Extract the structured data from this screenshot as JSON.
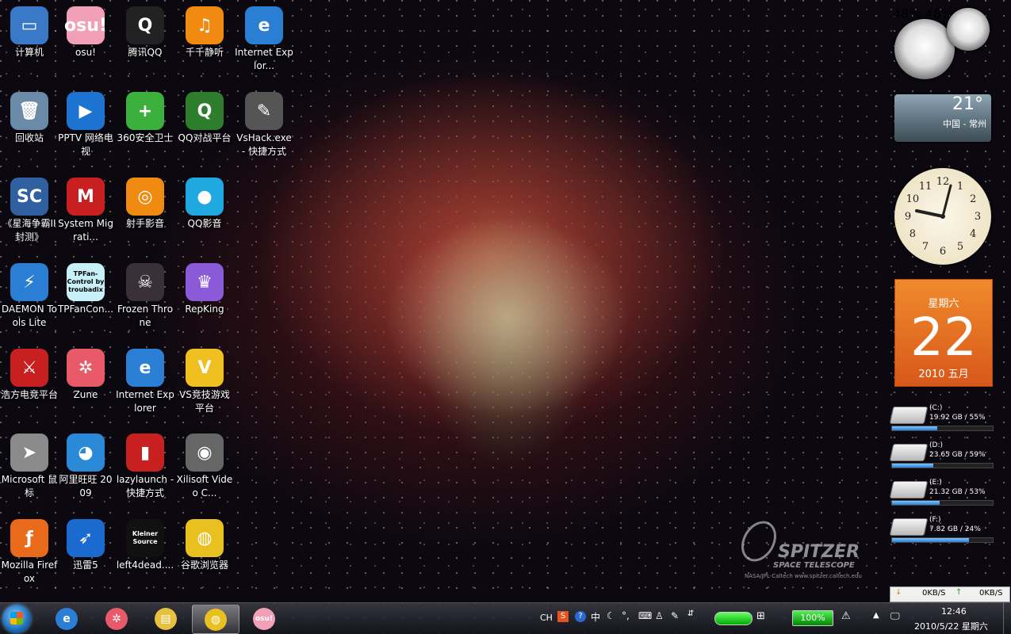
{
  "desktop": {
    "icons": [
      {
        "label": "计算机",
        "glyph": "▭",
        "color": "#3a78c8"
      },
      {
        "label": "osu!",
        "glyph": "osu!",
        "color": "#f2a0b8"
      },
      {
        "label": "腾讯QQ",
        "glyph": "Q",
        "color": "#222"
      },
      {
        "label": "千千静听",
        "glyph": "♫",
        "color": "#f08a10"
      },
      {
        "label": "Internet Explor...",
        "glyph": "e",
        "color": "#2a7fd4"
      },
      {
        "label": "回收站",
        "glyph": "🗑",
        "color": "#6a8aa8"
      },
      {
        "label": "PPTV 网络电视",
        "glyph": "▶",
        "color": "#1c74d0"
      },
      {
        "label": "360安全卫士",
        "glyph": "+",
        "color": "#3cb03c"
      },
      {
        "label": "QQ对战平台",
        "glyph": "Q",
        "color": "#2d7d2d"
      },
      {
        "label": "VsHack.exe - 快捷方式",
        "glyph": "✎",
        "color": "#555"
      },
      {
        "label": "《星海争霸II 封测》",
        "glyph": "SC",
        "color": "#3060a0"
      },
      {
        "label": "System Migrati...",
        "glyph": "M",
        "color": "#c82020"
      },
      {
        "label": "射手影音",
        "glyph": "◎",
        "color": "#f08a10"
      },
      {
        "label": "QQ影音",
        "glyph": "●",
        "color": "#20a8e0"
      },
      {
        "label": "",
        "glyph": "",
        "color": "transparent"
      },
      {
        "label": "DAEMON Tools Lite",
        "glyph": "⚡",
        "color": "#2a7fd4"
      },
      {
        "label": "TPFanCon...",
        "glyph": "TPFan-Control by troubadix",
        "color": "#c8f0f8"
      },
      {
        "label": "Frozen Throne",
        "glyph": "☠",
        "color": "#3a3038"
      },
      {
        "label": "RepKing",
        "glyph": "♛",
        "color": "#8a5ad8"
      },
      {
        "label": "",
        "glyph": "",
        "color": "transparent"
      },
      {
        "label": "浩方电竞平台",
        "glyph": "⚔",
        "color": "#c82020"
      },
      {
        "label": "Zune",
        "glyph": "✲",
        "color": "#e85a6a"
      },
      {
        "label": "Internet Explorer",
        "glyph": "e",
        "color": "#2a7fd4"
      },
      {
        "label": "VS竞技游戏平台",
        "glyph": "V",
        "color": "#f0c020"
      },
      {
        "label": "",
        "glyph": "",
        "color": "transparent"
      },
      {
        "label": "Microsoft 鼠标",
        "glyph": "➤",
        "color": "#8a8a8a"
      },
      {
        "label": "阿里旺旺 2009",
        "glyph": "◕",
        "color": "#2a8ad8"
      },
      {
        "label": "lazylaunch - 快捷方式",
        "glyph": "▮",
        "color": "#c82020"
      },
      {
        "label": "Xilisoft Video C...",
        "glyph": "◉",
        "color": "#666"
      },
      {
        "label": "",
        "glyph": "",
        "color": "transparent"
      },
      {
        "label": "Mozilla Firefox",
        "glyph": "ƒ",
        "color": "#e86a1a"
      },
      {
        "label": "迅雷5",
        "glyph": "➶",
        "color": "#1a6ad0"
      },
      {
        "label": "left4dead....",
        "glyph": "Kleiner Source",
        "color": "#111"
      },
      {
        "label": "谷歌浏览器",
        "glyph": "◍",
        "color": "#e8c020"
      }
    ]
  },
  "gadgets": {
    "cpu_meter": {
      "cpu_pct": "48%",
      "mem_pct": "48%"
    },
    "weather": {
      "temp": "21°",
      "location": "中国 - 常州"
    },
    "clock": {
      "numbers": [
        "12",
        "1",
        "2",
        "3",
        "4",
        "5",
        "6",
        "7",
        "8",
        "9",
        "10",
        "11"
      ]
    },
    "calendar": {
      "weekday": "星期六",
      "day": "22",
      "month_year": "2010 五月"
    },
    "drives": [
      {
        "name": "(C:)",
        "info": "19.92 GB / 55%",
        "fill": 0.45
      },
      {
        "name": "(D:)",
        "info": "23.65 GB / 59%",
        "fill": 0.41
      },
      {
        "name": "(E:)",
        "info": "21.32 GB / 53%",
        "fill": 0.47
      },
      {
        "name": "(F:)",
        "info": "7.82 GB / 24%",
        "fill": 0.76
      }
    ],
    "network": {
      "down": "0KB/S",
      "up": "0KB/S"
    }
  },
  "watermark": {
    "title": "SPITZER",
    "subtitle": "SPACE TELESCOPE",
    "credit": "NASA/JPL-Caltech   www.spitzer.caltech.edu"
  },
  "taskbar": {
    "pinned": [
      {
        "name": "ie",
        "glyph": "e",
        "color": "#2a7fd4"
      },
      {
        "name": "zune",
        "glyph": "✲",
        "color": "#e85a6a"
      },
      {
        "name": "explorer",
        "glyph": "▤",
        "color": "#e8c040"
      },
      {
        "name": "chrome",
        "glyph": "◍",
        "color": "#e8c020"
      },
      {
        "name": "osu",
        "glyph": "osu!",
        "color": "#f2a0b8"
      }
    ],
    "tray": {
      "lang": "CH",
      "battery_text": "100%",
      "time": "12:46",
      "date": "2010/5/22 星期六"
    }
  }
}
